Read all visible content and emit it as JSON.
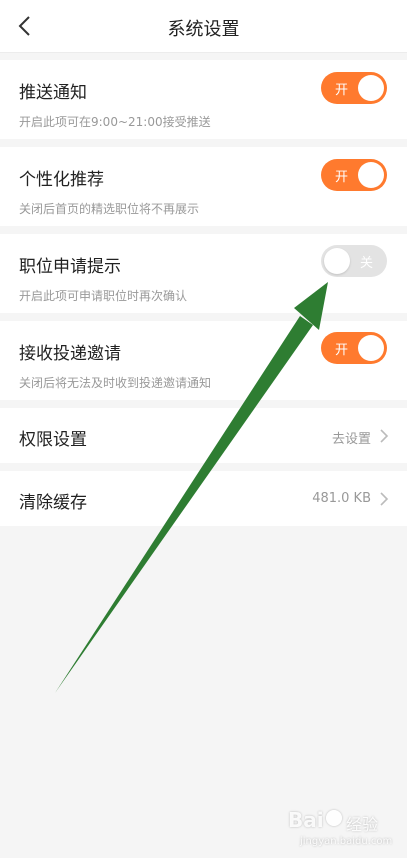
{
  "header": {
    "title": "系统设置"
  },
  "settings": [
    {
      "title": "推送通知",
      "desc": "开启此项可在9:00~21:00接受推送",
      "toggle_label": "开",
      "on": true
    },
    {
      "title": "个性化推荐",
      "desc": "关闭后首页的精选职位将不再展示",
      "toggle_label": "开",
      "on": true
    },
    {
      "title": "职位申请提示",
      "desc": "开启此项可申请职位时再次确认",
      "toggle_label": "关",
      "on": false
    },
    {
      "title": "接收投递邀请",
      "desc": "关闭后将无法及时收到投递邀请通知",
      "toggle_label": "开",
      "on": true
    }
  ],
  "links": [
    {
      "title": "权限设置",
      "value": "去设置"
    },
    {
      "title": "清除缓存",
      "value": "481.0 KB"
    }
  ],
  "watermark": {
    "brand": "Bai",
    "suffix": "经验",
    "url": "jingyan.baidu.com"
  },
  "colors": {
    "accent": "#ff7a2e",
    "annotation_arrow": "#2e7d32"
  }
}
